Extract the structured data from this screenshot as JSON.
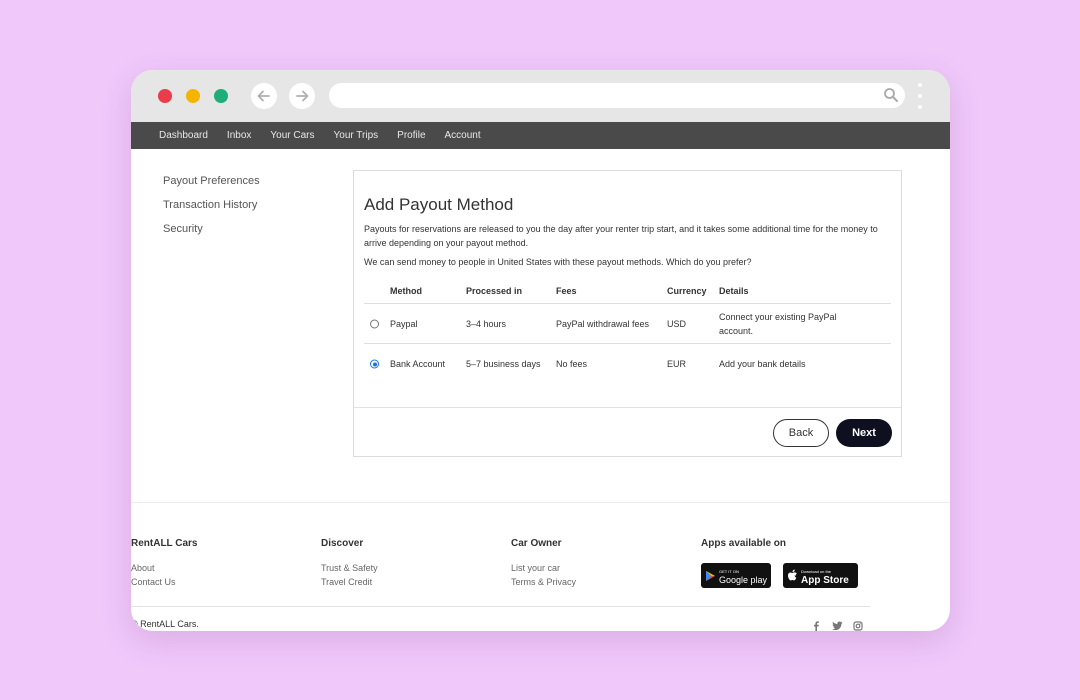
{
  "window_controls": {
    "close_color": "#ea3c4b",
    "minimize_color": "#f5b400",
    "maximize_color": "#1fae7a"
  },
  "topnav": {
    "items": [
      "Dashboard",
      "Inbox",
      "Your Cars",
      "Your Trips",
      "Profile",
      "Account"
    ]
  },
  "sidebar": {
    "items": [
      "Payout Preferences",
      "Transaction History",
      "Security"
    ]
  },
  "panel": {
    "title": "Add Payout Method",
    "description": "Payouts for reservations are released to you the day after your renter trip start, and it takes some additional time for the money to arrive depending on your payout method.",
    "question": "We can send money to people in United States with these payout methods. Which do you prefer?",
    "table": {
      "headers": [
        "Method",
        "Processed in",
        "Fees",
        "Currency",
        "Details"
      ],
      "rows": [
        {
          "method": "Paypal",
          "processed": "3–4 hours",
          "fees": "PayPal withdrawal fees",
          "currency": "USD",
          "details": "Connect your existing PayPal account.",
          "selected": false
        },
        {
          "method": "Bank Account",
          "processed": "5–7 business days",
          "fees": "No fees",
          "currency": "EUR",
          "details": "Add your bank details",
          "selected": true
        }
      ]
    },
    "back_label": "Back",
    "next_label": "Next"
  },
  "footer": {
    "columns": [
      {
        "heading": "RentALL Cars",
        "links": [
          "About",
          "Contact Us"
        ]
      },
      {
        "heading": "Discover",
        "links": [
          "Trust & Safety",
          "Travel Credit"
        ]
      },
      {
        "heading": "Car Owner",
        "links": [
          "List your car",
          "Terms & Privacy"
        ]
      }
    ],
    "apps": {
      "heading": "Apps available on",
      "google_small": "GET IT ON",
      "google_big": "Google play",
      "apple_small": "Download on the",
      "apple_big": "App Store"
    },
    "copyright": "© RentALL Cars.",
    "social_icons": [
      "facebook-icon",
      "twitter-icon",
      "instagram-icon"
    ]
  }
}
